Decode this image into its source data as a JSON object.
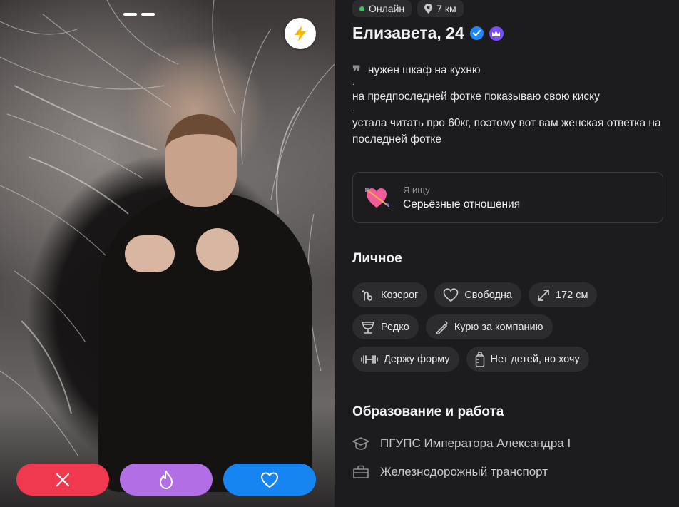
{
  "photo": {
    "story_count": 2,
    "boost_icon": "lightning-icon",
    "actions": [
      {
        "name": "dislike",
        "icon": "close-icon",
        "color": "#f0384f"
      },
      {
        "name": "superlike",
        "icon": "fire-icon",
        "color": "#b26fe5"
      },
      {
        "name": "like",
        "icon": "heart-icon",
        "color": "#1684f1"
      }
    ]
  },
  "status": {
    "online": "Онлайн",
    "distance": "7 км"
  },
  "profile": {
    "name_age": "Елизавета, 24",
    "verified_icon": "verified-check-icon",
    "premium_icon": "crown-icon"
  },
  "bio": {
    "line1": "нужен шкаф на кухню",
    "sep1": ".",
    "line2": "на предпоследней фотке показываю свою киску",
    "sep2": ".",
    "line3": "устала читать про 60кг, поэтому вот вам женская ответка на последней фотке"
  },
  "looking_for": {
    "label": "Я ищу",
    "value": "Серьёзные отношения",
    "icon": "heart-arrow-icon"
  },
  "personal": {
    "title": "Личное",
    "tags": [
      {
        "icon": "capricorn-icon",
        "label": "Козерог"
      },
      {
        "icon": "heart-outline-icon",
        "label": "Свободна"
      },
      {
        "icon": "height-arrows-icon",
        "label": "172 см"
      },
      {
        "icon": "glass-icon",
        "label": "Редко"
      },
      {
        "icon": "cigarette-icon",
        "label": "Курю за компанию"
      },
      {
        "icon": "dumbbell-icon",
        "label": "Держу форму"
      },
      {
        "icon": "baby-bottle-icon",
        "label": "Нет детей, но хочу"
      }
    ]
  },
  "education": {
    "title": "Образование и работа",
    "school": "ПГУПС Императора Александра I",
    "work": "Железнодорожный транспорт"
  }
}
